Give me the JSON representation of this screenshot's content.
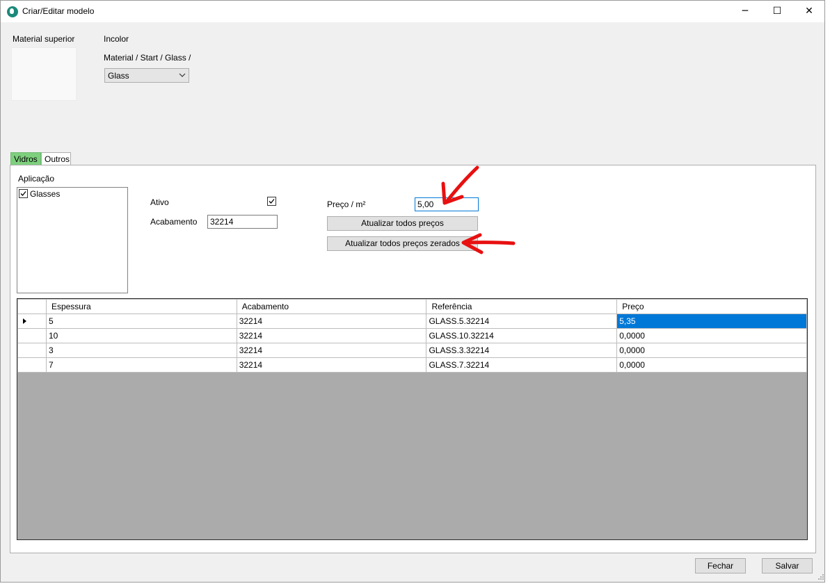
{
  "window": {
    "title": "Criar/Editar modelo",
    "minimize": "─",
    "maximize": "☐",
    "close": "✕"
  },
  "material": {
    "label": "Material superior",
    "name": "Incolor",
    "path": "Material / Start / Glass /",
    "selected": "Glass"
  },
  "tabs": [
    "Vidros",
    "Outros"
  ],
  "aplicacao": {
    "label": "Aplicação",
    "items": [
      {
        "label": "Glasses",
        "checked": true
      }
    ]
  },
  "form": {
    "ativo_label": "Ativo",
    "ativo_checked": true,
    "acabamento_label": "Acabamento",
    "acabamento_value": "32214",
    "preco_label": "Preço / m²",
    "preco_value": "5,00",
    "btn_atualizar": "Atualizar todos preços",
    "btn_atualizar_zerados": "Atualizar todos preços zerados"
  },
  "grid": {
    "columns": [
      "Espessura",
      "Acabamento",
      "Referência",
      "Preço"
    ],
    "rows": [
      [
        "5",
        "32214",
        "GLASS.5.32214",
        "5,35"
      ],
      [
        "10",
        "32214",
        "GLASS.10.32214",
        "0,0000"
      ],
      [
        "3",
        "32214",
        "GLASS.3.32214",
        "0,0000"
      ],
      [
        "7",
        "32214",
        "GLASS.7.32214",
        "0,0000"
      ]
    ]
  },
  "footer": {
    "fechar": "Fechar",
    "salvar": "Salvar"
  },
  "colors": {
    "tab_active": "#7ed07e",
    "selection": "#0078d7",
    "annotation": "#e81010"
  }
}
